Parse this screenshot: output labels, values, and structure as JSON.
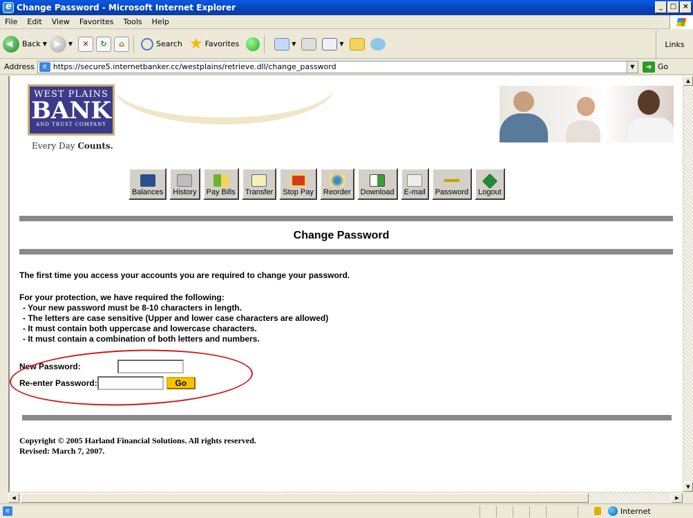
{
  "window": {
    "title": "Change Password - Microsoft Internet Explorer"
  },
  "menu": [
    "File",
    "Edit",
    "View",
    "Favorites",
    "Tools",
    "Help"
  ],
  "toolbar": {
    "back": "Back",
    "search": "Search",
    "favorites": "Favorites",
    "links": "Links"
  },
  "address": {
    "label": "Address",
    "url": "https://secure5.internetbanker.cc/westplains/retrieve.dll/change_password",
    "go": "Go"
  },
  "bank": {
    "logo_line1": "WEST PLAINS",
    "logo_line2": "BANK",
    "logo_line3": "AND TRUST COMPANY",
    "tagline_prefix": "Every Day",
    "tagline_bold": "Counts."
  },
  "nav": [
    {
      "label": "Balances",
      "color": "#2a4f8f"
    },
    {
      "label": "History",
      "color": "#9c9c9c"
    },
    {
      "label": "Pay Bills",
      "color": "#6bb52e"
    },
    {
      "label": "Transfer",
      "color": "#3a6ab8"
    },
    {
      "label": "Stop Pay",
      "color": "#d63a1a"
    },
    {
      "label": "Reorder",
      "color": "#e8c84a"
    },
    {
      "label": "Download",
      "color": "#3c9a3c"
    },
    {
      "label": "E-mail",
      "color": "#8f8f8f"
    },
    {
      "label": "Password",
      "color": "#c8a000"
    },
    {
      "label": "Logout",
      "color": "#1e8a3a"
    }
  ],
  "page": {
    "title": "Change Password",
    "intro": "The first time you access your accounts you are required to change your password.",
    "protection_heading": "For your protection, we have required the following:",
    "requirements": [
      "- Your new password must be 8-10 characters in length.",
      "- The letters are case sensitive (Upper and lower case characters are allowed)",
      "- It must contain both uppercase and lowercase characters.",
      "- It must contain a combination of both letters and numbers."
    ],
    "new_password_label": "New Password:",
    "reenter_password_label": "Re-enter Password:",
    "go_label": "Go",
    "copyright": "Copyright © 2005 Harland Financial Solutions.  All rights reserved.",
    "revised": "Revised: March 7, 2007."
  },
  "status": {
    "zone": "Internet"
  }
}
